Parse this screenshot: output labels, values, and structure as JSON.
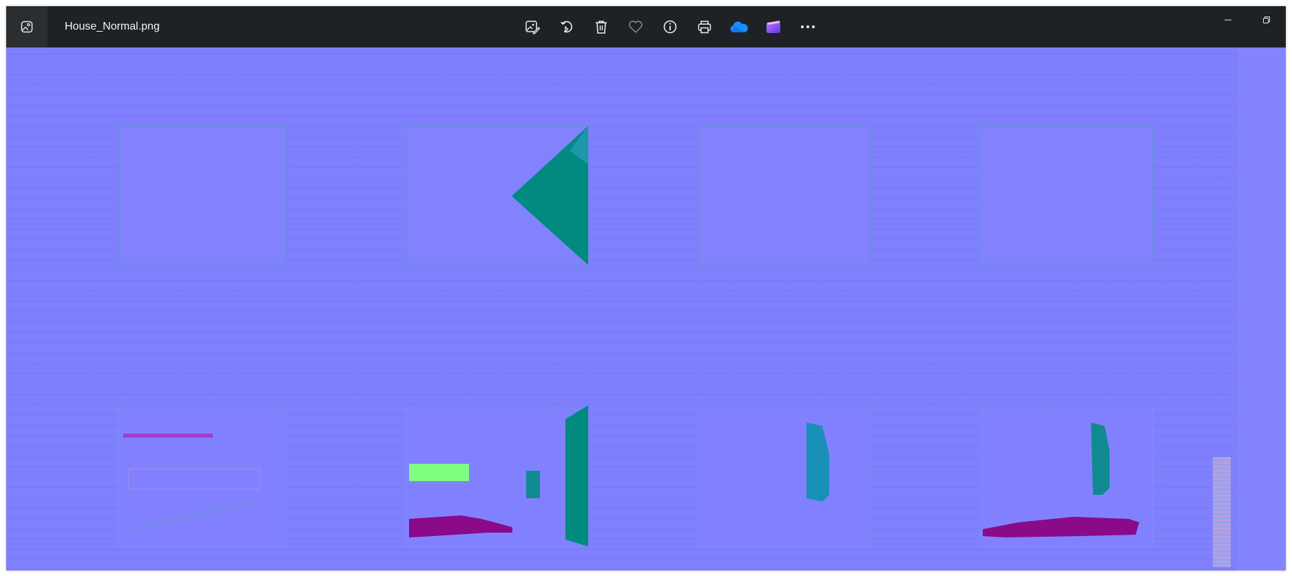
{
  "window": {
    "title": "House_Normal.png"
  },
  "toolbar": {
    "buttons": [
      {
        "name": "edit-image",
        "icon": "edit-image-icon"
      },
      {
        "name": "rotate",
        "icon": "rotate-icon"
      },
      {
        "name": "delete",
        "icon": "trash-icon"
      },
      {
        "name": "favorite",
        "icon": "heart-icon"
      },
      {
        "name": "info",
        "icon": "info-icon"
      },
      {
        "name": "print",
        "icon": "printer-icon"
      },
      {
        "name": "onedrive",
        "icon": "cloud-icon"
      },
      {
        "name": "clipchamp",
        "icon": "clipchamp-icon"
      },
      {
        "name": "more",
        "icon": "more-icon"
      }
    ]
  },
  "colors": {
    "titlebar": "#1f2225",
    "normal_base": "#8080ff",
    "teal": "#008a80",
    "green": "#80ff80",
    "magenta": "#8a0a8a",
    "onedrive_blue": "#1a8cff"
  }
}
